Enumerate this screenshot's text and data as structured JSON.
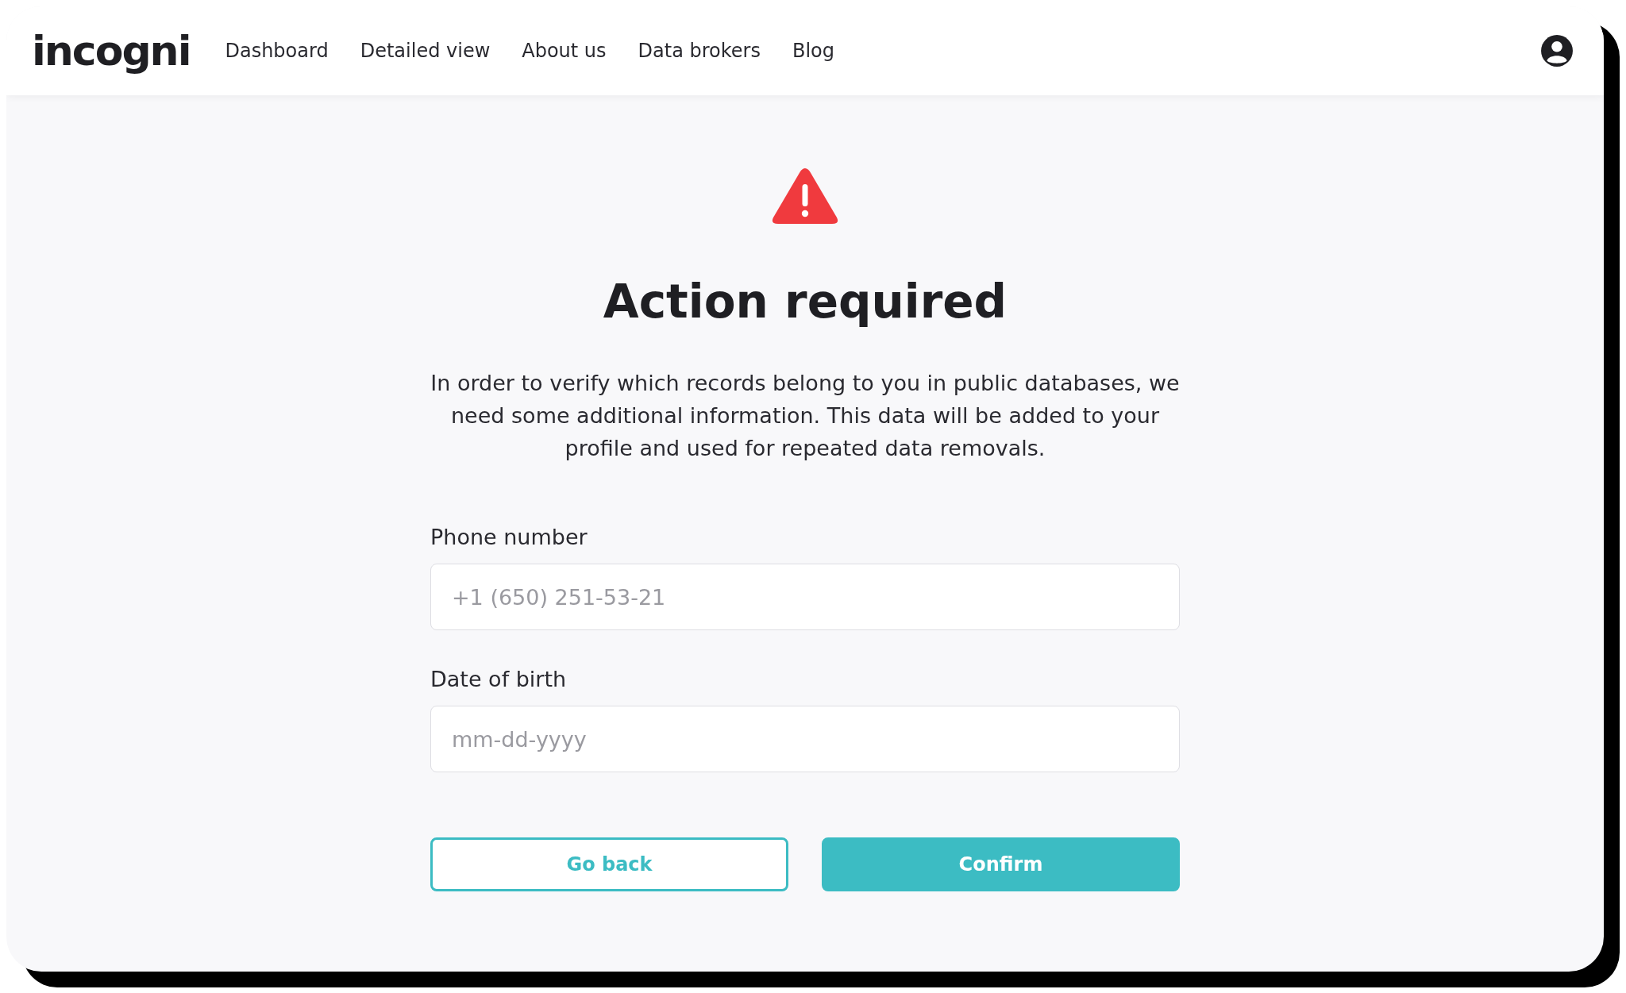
{
  "header": {
    "logo": "incogni",
    "nav": [
      {
        "label": "Dashboard"
      },
      {
        "label": "Detailed view"
      },
      {
        "label": "About us"
      },
      {
        "label": "Data brokers"
      },
      {
        "label": "Blog"
      }
    ]
  },
  "main": {
    "title": "Action required",
    "message": "In order to verify which records belong to you in public databases, we need some additional information. This data will be added to your profile and used for repeated data removals.",
    "fields": [
      {
        "label": "Phone number",
        "placeholder": "+1 (650) 251-53-21"
      },
      {
        "label": "Date of birth",
        "placeholder": "mm-dd-yyyy"
      }
    ],
    "buttons": [
      {
        "label": "Go back",
        "kind": "secondary"
      },
      {
        "label": "Confirm",
        "kind": "primary"
      }
    ]
  }
}
